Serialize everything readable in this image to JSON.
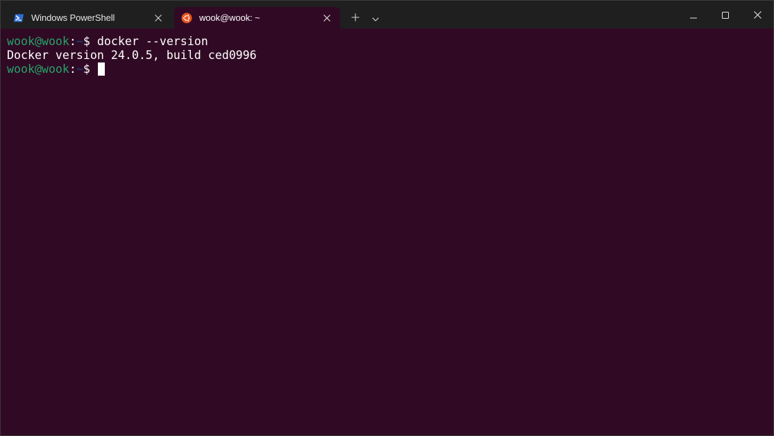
{
  "tabs": [
    {
      "title": "Windows PowerShell",
      "icon": "powershell-icon",
      "active": false
    },
    {
      "title": "wook@wook: ~",
      "icon": "ubuntu-icon",
      "active": true
    }
  ],
  "terminal": {
    "lines": [
      {
        "user_host": "wook@wook",
        "colon": ":",
        "path": "~",
        "dollar": "$",
        "command": " docker --version"
      },
      {
        "output": "Docker version 24.0.5, build ced0996"
      },
      {
        "user_host": "wook@wook",
        "colon": ":",
        "path": "~",
        "dollar": "$",
        "command": " "
      }
    ]
  },
  "colors": {
    "terminal_background": "#300a24",
    "prompt_user_host": "#26a269",
    "prompt_path": "#12488b",
    "titlebar": "#1f1f1f"
  }
}
